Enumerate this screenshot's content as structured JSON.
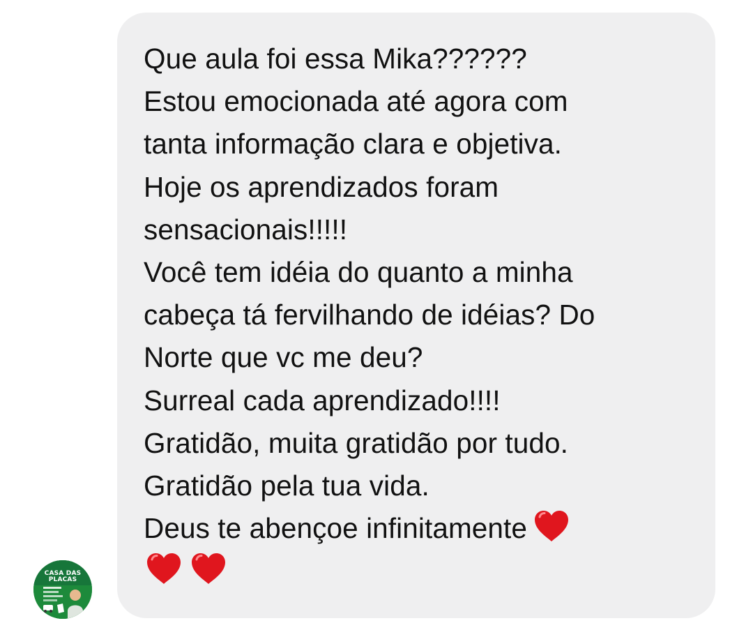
{
  "message": {
    "lines": [
      "Que aula foi essa Mika??????",
      "Estou emocionada até agora com",
      "tanta informação clara e objetiva.",
      "Hoje os aprendizados foram",
      "sensacionais!!!!!",
      "Você tem idéia do quanto a minha",
      "cabeça tá fervilhando de idéias? Do",
      "Norte que vc me deu?",
      "Surreal cada aprendizado!!!!",
      "Gratidão, muita gratidão por tudo.",
      "Gratidão pela tua vida.",
      "Deus te abençoe infinitamente"
    ],
    "hearts_total": 3
  },
  "avatar": {
    "logo_line1": "CASA DAS",
    "logo_line2": "PLACAS"
  },
  "colors": {
    "bubble": "#efeff0",
    "text": "#111111",
    "heart": "#e0161e",
    "avatar_green": "#1d8a3b"
  }
}
